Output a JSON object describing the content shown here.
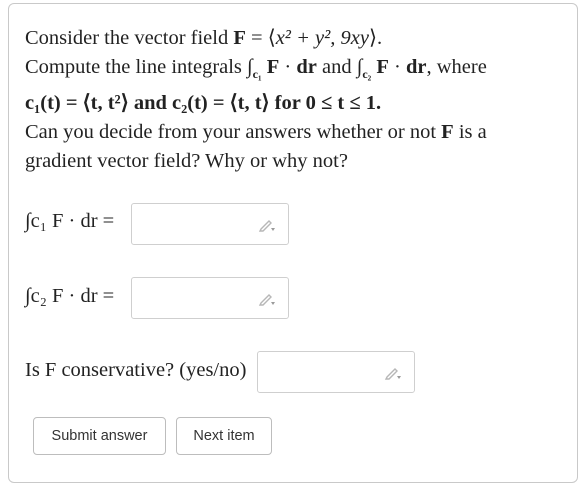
{
  "problem": {
    "line1_text": "Consider the vector field ",
    "line1_field": "F",
    "line1_eq": " = ⟨",
    "line1_math": "x² + y², 9xy",
    "line1_end": "⟩.",
    "line2_pre": "Compute the line integrals ",
    "line2_and": " and ",
    "line2_post": ", where",
    "line3": "c₁(t) = ⟨t, t²⟩ and c₂(t) = ⟨t, t⟩ for 0 ≤ t ≤ 1.",
    "line4_pre": "Can you decide from your answers whether or not ",
    "line4_field": "F",
    "line4_post": " is a",
    "line5": "gradient vector field? Why or why not?"
  },
  "answers": [
    {
      "label": "∫c₁ F · dr =",
      "value": ""
    },
    {
      "label": "∫c₂ F · dr =",
      "value": ""
    },
    {
      "label": "Is F conservative? (yes/no)",
      "value": ""
    }
  ],
  "buttons": {
    "submit": "Submit answer",
    "next": "Next item"
  },
  "icons": [
    "pencil-icon"
  ],
  "colors": {
    "text": "#222222",
    "border": "#c9c9c9",
    "button_text": "#333333"
  }
}
